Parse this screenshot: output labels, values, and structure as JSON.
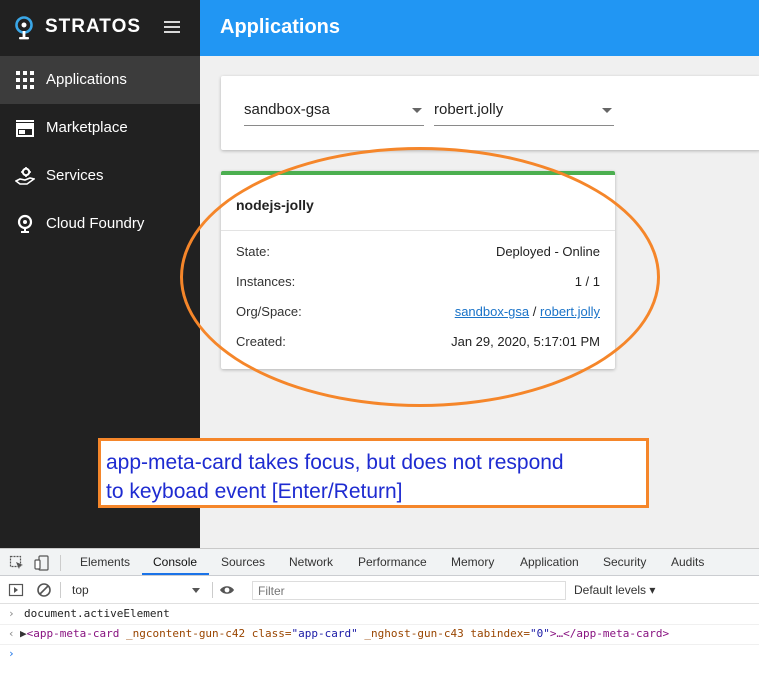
{
  "brand": {
    "name": "STRATOS"
  },
  "header": {
    "title": "Applications"
  },
  "sidebar": {
    "items": [
      {
        "label": "Applications",
        "icon": "grid-icon",
        "active": true
      },
      {
        "label": "Marketplace",
        "icon": "store-icon",
        "active": false
      },
      {
        "label": "Services",
        "icon": "services-hand-icon",
        "active": false
      },
      {
        "label": "Cloud Foundry",
        "icon": "cloud-foundry-icon",
        "active": false
      }
    ]
  },
  "filters": {
    "org": {
      "value": "sandbox-gsa"
    },
    "space": {
      "value": "robert.jolly"
    }
  },
  "app_card": {
    "name": "nodejs-jolly",
    "status_color": "#4caf50",
    "rows": {
      "state": {
        "label": "State:",
        "value": "Deployed - Online"
      },
      "instances": {
        "label": "Instances:",
        "value": "1 / 1"
      },
      "org_space": {
        "label": "Org/Space:",
        "org": "sandbox-gsa",
        "separator": "/",
        "space": "robert.jolly"
      },
      "created": {
        "label": "Created:",
        "value": "Jan 29, 2020, 5:17:01 PM"
      }
    }
  },
  "annotation": {
    "line1": "app-meta-card takes focus, but does not respond",
    "line2": "to keyboad event [Enter/Return]",
    "color": "#f5862a",
    "text_color": "#1e2bd1"
  },
  "devtools": {
    "tabs": [
      "Elements",
      "Console",
      "Sources",
      "Network",
      "Performance",
      "Memory",
      "Application",
      "Security",
      "Audits"
    ],
    "active_tab": "Console",
    "context": "top",
    "filter_placeholder": "Filter",
    "levels": "Default levels ▾",
    "console": {
      "input": "document.activeElement",
      "output": {
        "tag_open": "<app-meta-card",
        "attr1": " _ngcontent-gun-c42",
        "attr2_name": " class=",
        "attr2_value": "\"app-card\"",
        "attr3": " _nghost-gun-c43",
        "attr4_name": " tabindex=",
        "attr4_value": "\"0\"",
        "middle": ">…",
        "tag_close": "</app-meta-card>"
      }
    }
  }
}
